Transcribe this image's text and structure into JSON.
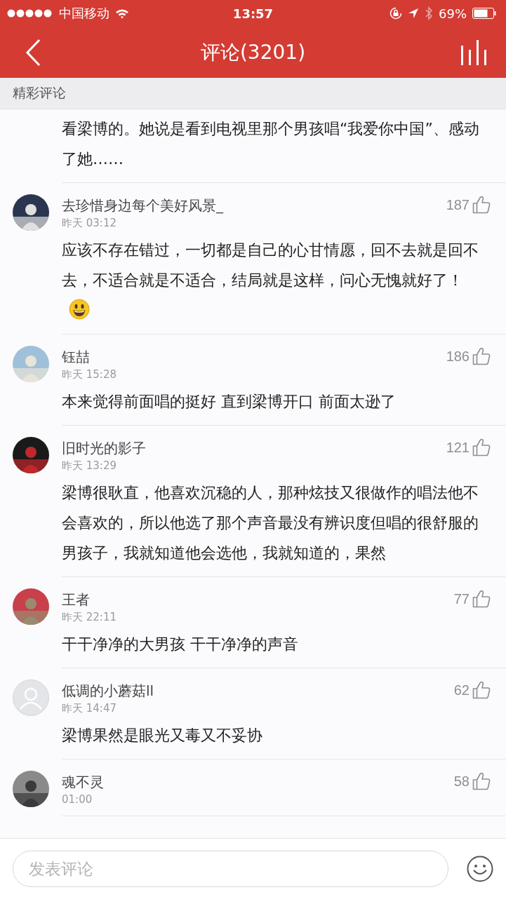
{
  "status_bar": {
    "carrier": "中国移动",
    "time": "13:57",
    "battery": "69%"
  },
  "nav": {
    "title": "评论(3201)"
  },
  "section": {
    "title": "精彩评论"
  },
  "comments": [
    {
      "kind": "partial",
      "body": "看梁博的。她说是看到电视里那个男孩唱“我爱你中国”、感动了她……"
    },
    {
      "user": "去珍惜身边每个美好风景_",
      "time": "昨天 03:12",
      "likes": "187",
      "body": "应该不存在错过，一切都是自己的心甘情愿，回不去就是回不去，不适合就是不适合，结局就是这样，问心无愧就好了！",
      "emoji": true
    },
    {
      "user": "钰喆",
      "time": "昨天 15:28",
      "likes": "186",
      "body": "本来觉得前面唱的挺好 直到梁博开口 前面太逊了",
      "emoji": false
    },
    {
      "user": "旧时光的影子",
      "time": "昨天 13:29",
      "likes": "121",
      "body": "梁博很耿直，他喜欢沉稳的人，那种炫技又很做作的唱法他不会喜欢的，所以他选了那个声音最没有辨识度但唱的很舒服的男孩子，我就知道他会选他，我就知道的，果然",
      "emoji": false
    },
    {
      "user": "王者",
      "time": "昨天 22:11",
      "likes": "77",
      "body": "干干净净的大男孩 干干净净的声音",
      "emoji": false
    },
    {
      "kind": "default",
      "user": "低调的小蘑菇ll",
      "time": "昨天 14:47",
      "likes": "62",
      "body": "梁博果然是眼光又毒又不妥协",
      "emoji": false
    },
    {
      "user": "魂不灵",
      "time": "01:00",
      "likes": "58",
      "emoji": false
    }
  ],
  "composer": {
    "placeholder": "发表评论"
  }
}
